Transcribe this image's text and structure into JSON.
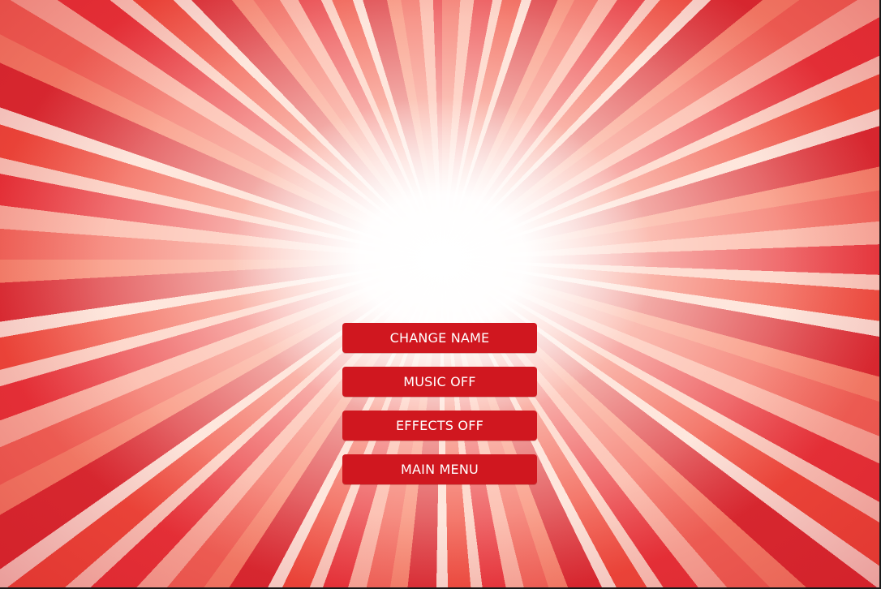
{
  "menu": {
    "buttons": [
      {
        "label": "CHANGE NAME"
      },
      {
        "label": "MUSIC OFF"
      },
      {
        "label": "EFFECTS OFF"
      },
      {
        "label": "MAIN MENU"
      }
    ]
  },
  "colors": {
    "button_bg": "#d0171f",
    "button_text": "#ffffff",
    "background_accent": "#e63a36"
  }
}
